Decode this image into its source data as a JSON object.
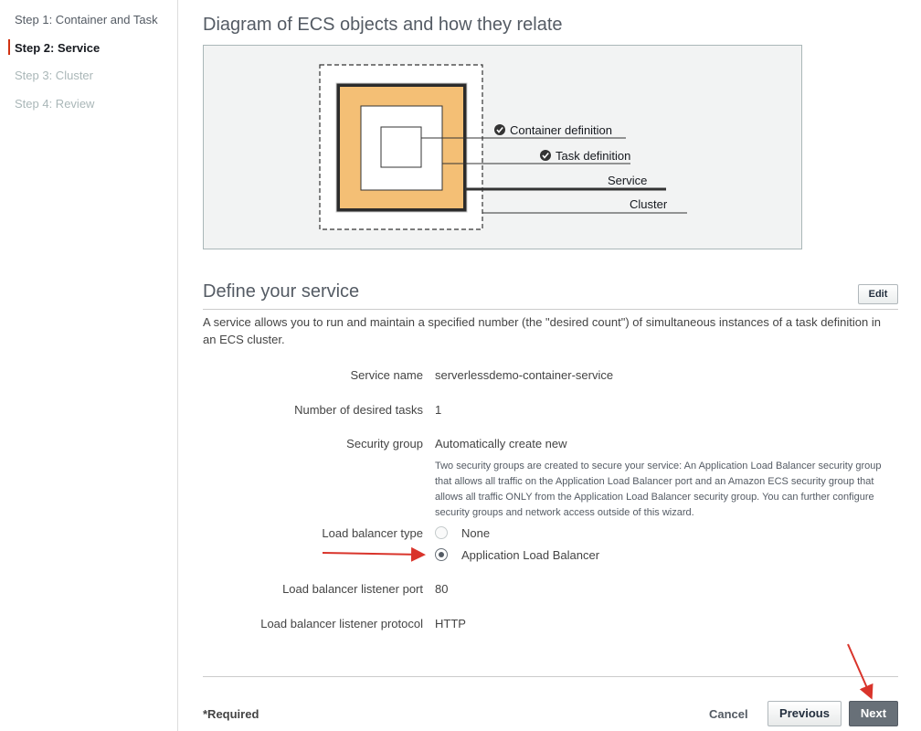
{
  "sidebar": {
    "steps": [
      {
        "label": "Step 1: Container and Task",
        "state": "done"
      },
      {
        "label": "Step 2: Service",
        "state": "active"
      },
      {
        "label": "Step 3: Cluster",
        "state": "disabled"
      },
      {
        "label": "Step 4: Review",
        "state": "disabled"
      }
    ],
    "active_marker_color": "#d13212"
  },
  "diagram": {
    "title": "Diagram of ECS objects and how they relate",
    "labels": {
      "container_definition": "Container definition",
      "task_definition": "Task definition",
      "service": "Service",
      "cluster": "Cluster"
    },
    "service_fill_color": "#f4bf75"
  },
  "service": {
    "heading": "Define your service",
    "edit_label": "Edit",
    "description": "A service allows you to run and maintain a specified number (the \"desired count\") of simultaneous instances of a task definition in an ECS cluster.",
    "fields": {
      "service_name": {
        "label": "Service name",
        "value": "serverlessdemo-container-service"
      },
      "desired_tasks": {
        "label": "Number of desired tasks",
        "value": "1"
      },
      "security_group": {
        "label": "Security group",
        "value": "Automatically create new",
        "help": "Two security groups are created to secure your service: An Application Load Balancer security group that allows all traffic on the Application Load Balancer port and an Amazon ECS security group that allows all traffic ONLY from the Application Load Balancer security group. You can further configure security groups and network access outside of this wizard."
      },
      "load_balancer_type": {
        "label": "Load balancer type",
        "options": [
          "None",
          "Application Load Balancer"
        ],
        "selected": "Application Load Balancer"
      },
      "listener_port": {
        "label": "Load balancer listener port",
        "value": "80"
      },
      "listener_protocol": {
        "label": "Load balancer listener protocol",
        "value": "HTTP"
      }
    }
  },
  "footer": {
    "required_label": "*Required",
    "cancel_label": "Cancel",
    "previous_label": "Previous",
    "next_label": "Next"
  },
  "annotation_color": "#d9342b"
}
